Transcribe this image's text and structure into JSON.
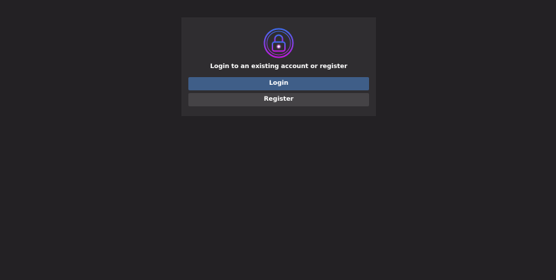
{
  "auth": {
    "prompt": "Login to an existing account or register",
    "login_label": "Login",
    "register_label": "Register"
  },
  "icons": {
    "lock": "lock-icon"
  },
  "colors": {
    "background": "#232124",
    "card": "#2f2d30",
    "login_button": "#3f5e88",
    "register_button": "#454346",
    "icon_gradient_start": "#3f6df0",
    "icon_gradient_end": "#c21ae0"
  }
}
